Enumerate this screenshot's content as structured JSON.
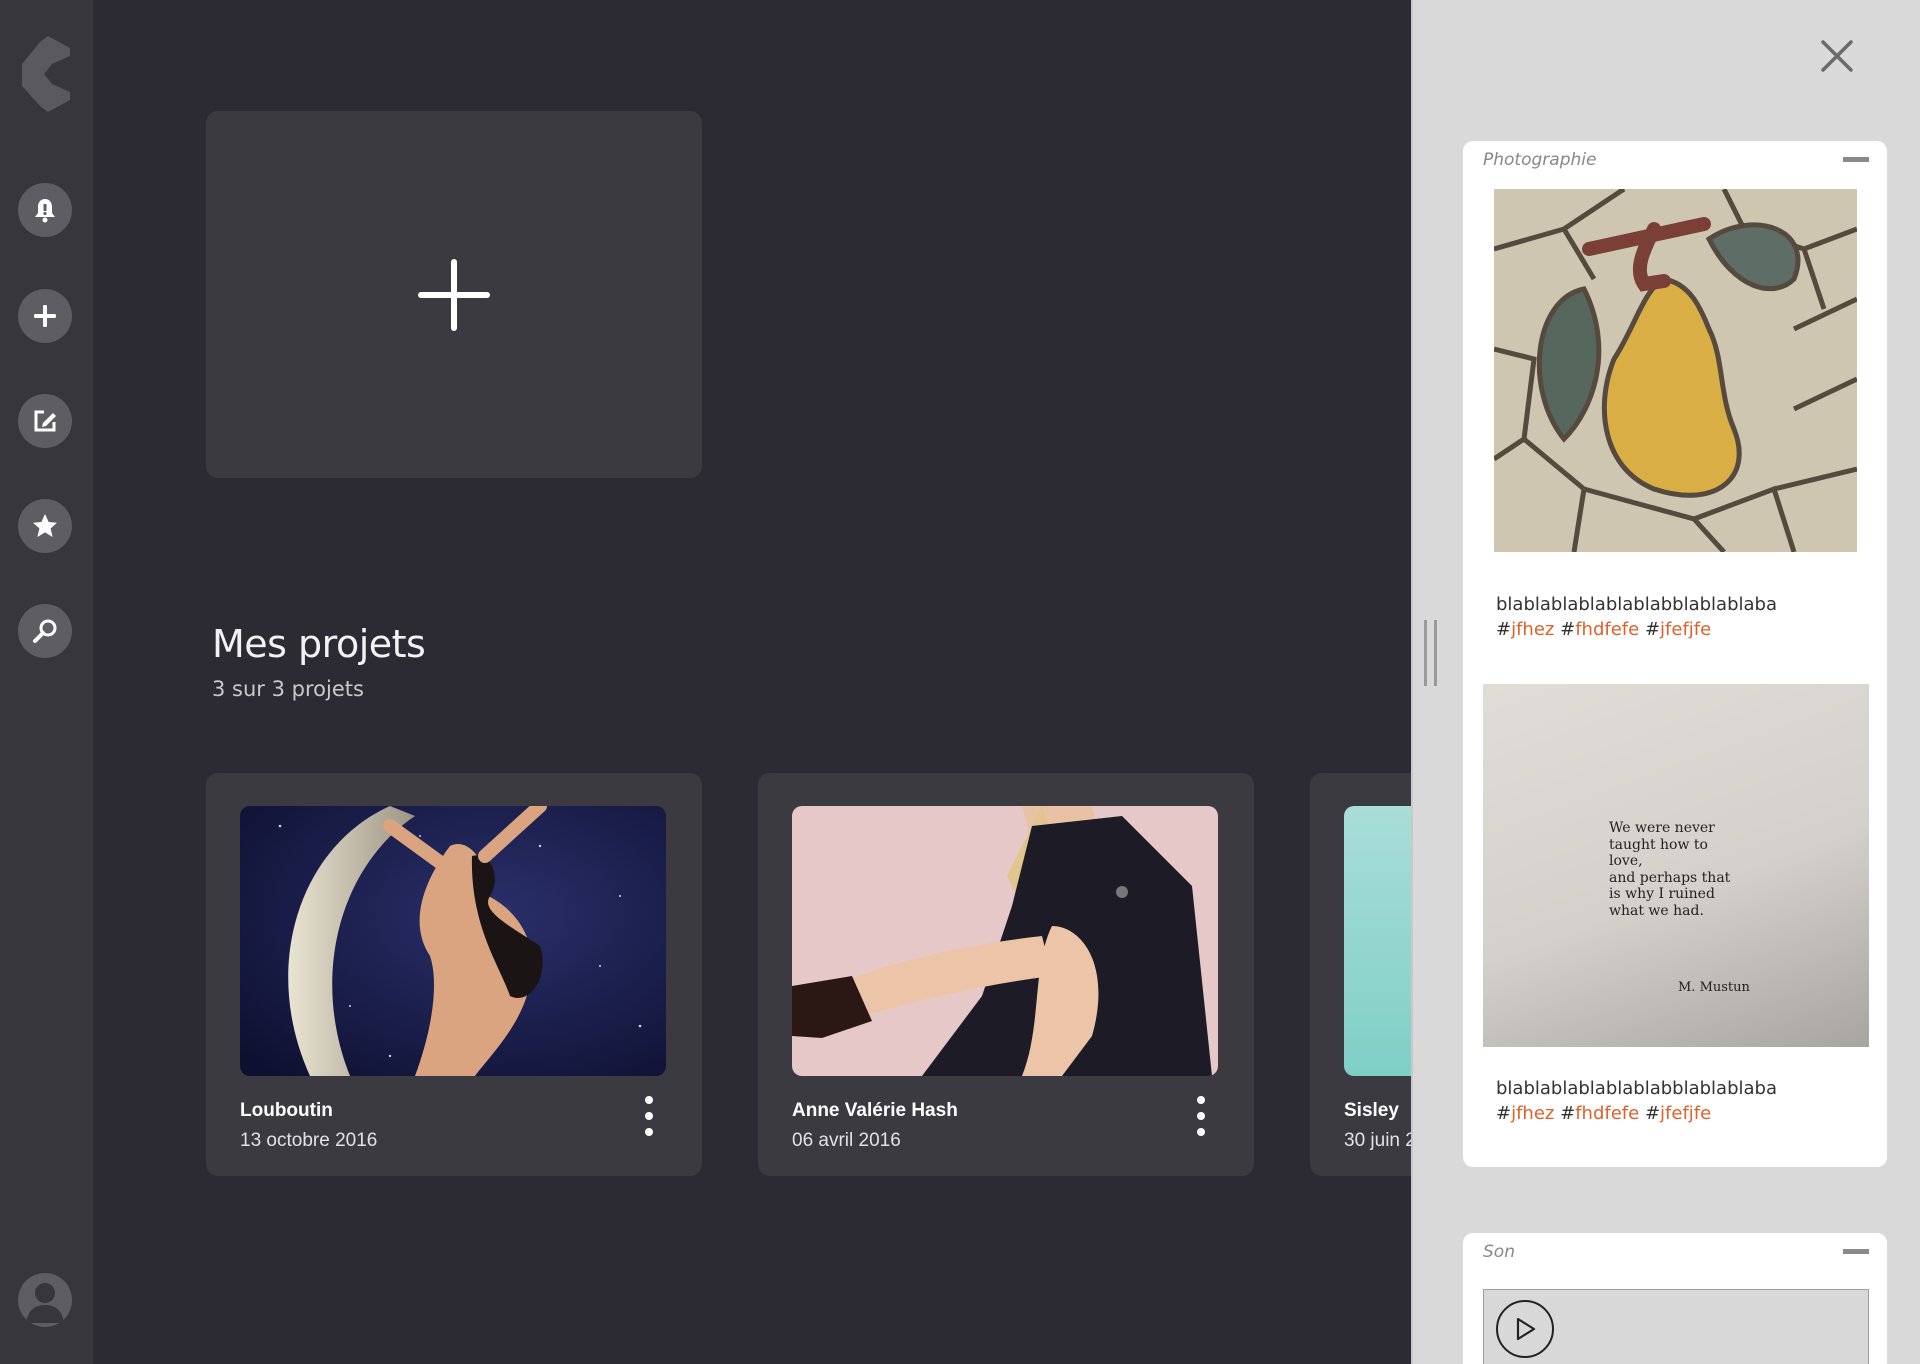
{
  "sidebar": {
    "logo": "brand-logo",
    "items": [
      {
        "icon": "bell-icon",
        "label": "Notifications"
      },
      {
        "icon": "plus-icon",
        "label": "Ajouter"
      },
      {
        "icon": "edit-icon",
        "label": "Éditer"
      },
      {
        "icon": "star-icon",
        "label": "Favoris"
      },
      {
        "icon": "search-icon",
        "label": "Rechercher"
      }
    ],
    "avatar_icon": "user-icon"
  },
  "main": {
    "add_card_icon": "plus-icon",
    "section_title": "Mes projets",
    "section_count": "3 sur 3 projets",
    "projects": [
      {
        "name": "Louboutin",
        "date": "13 octobre 2016"
      },
      {
        "name": "Anne Valérie Hash",
        "date": "06 avril 2016"
      },
      {
        "name": "Sisley",
        "date": "30 juin 2"
      }
    ]
  },
  "panel": {
    "close_icon": "close-icon",
    "widgets": [
      {
        "title": "Photographie",
        "posts": [
          {
            "text": "blablablablablablabblablablaba",
            "tags": [
              "jfhez",
              "fhdfefe",
              "jfefjfe"
            ]
          },
          {
            "text": "blablablablablablabblablablaba",
            "tags": [
              "jfhez",
              "fhdfefe",
              "jfefjfe"
            ],
            "quote": [
              "We were never",
              "taught how to",
              "love,",
              "and perhaps that",
              "is why I ruined",
              "what we had."
            ],
            "quote_author": "M. Mustun"
          }
        ]
      },
      {
        "title": "Son",
        "play_icon": "play-icon"
      }
    ]
  },
  "colors": {
    "background": "#2c2b33",
    "sidebar": "#37363c",
    "card": "#3b3a41",
    "panel": "#d9d9d9",
    "tag": "#e0602a"
  }
}
